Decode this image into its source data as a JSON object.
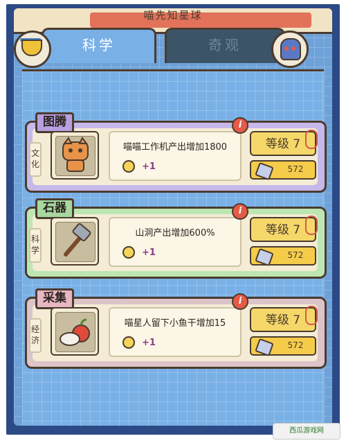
{
  "header": {
    "title": "喵先知星球"
  },
  "tabs": [
    {
      "label": "科学",
      "active": true
    },
    {
      "label": "奇观",
      "active": false
    }
  ],
  "cards": [
    {
      "category": "图腾",
      "category_color": "#b89fe0",
      "card_color": "#c6b9ea",
      "side_label": "文化",
      "icon": "cat-totem-icon",
      "description": "喵喵工作机产出增加1800",
      "bonus": "+1",
      "level": "等级 7",
      "cost": "572"
    },
    {
      "category": "石器",
      "category_color": "#a6d8a0",
      "card_color": "#bde6b2",
      "side_label": "科学",
      "icon": "stone-hammer-icon",
      "description": "山洞产出增加600%",
      "bonus": "+1",
      "level": "等级 7",
      "cost": "572"
    },
    {
      "category": "采集",
      "category_color": "#e8b7c4",
      "card_color": "#dcc4c8",
      "side_label": "经济",
      "icon": "apple-gather-icon",
      "description": "喵星人留下小鱼干增加15",
      "bonus": "+1",
      "level": "等级 7",
      "cost": "572"
    }
  ],
  "watermark": "西瓜游戏网"
}
